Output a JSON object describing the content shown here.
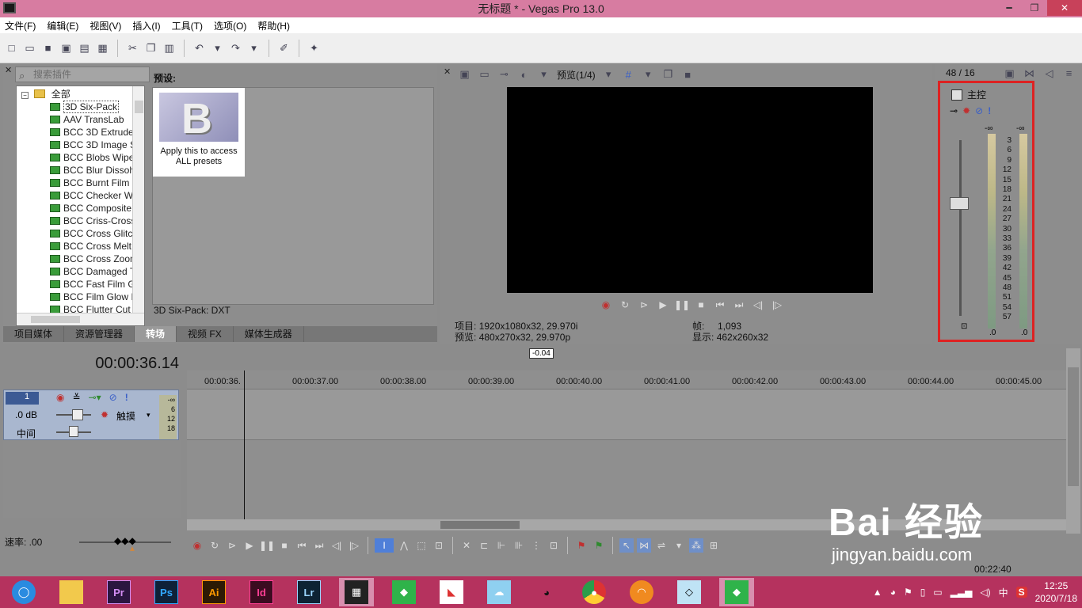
{
  "window": {
    "title": "无标题 * - Vegas Pro 13.0",
    "min": "━",
    "restore": "❐",
    "close": "✕"
  },
  "menu": [
    "文件(F)",
    "编辑(E)",
    "视图(V)",
    "插入(I)",
    "工具(T)",
    "选项(O)",
    "帮助(H)"
  ],
  "plugins": {
    "search_placeholder": "搜索插件",
    "root": "全部",
    "items": [
      "3D Six-Pack",
      "AAV TransLab",
      "BCC 3D Extrude",
      "BCC 3D Image S",
      "BCC Blobs Wipe",
      "BCC Blur Dissolv",
      "BCC Burnt Film",
      "BCC Checker Wi",
      "BCC Composite",
      "BCC Criss-Cross",
      "BCC Cross Glitch",
      "BCC Cross Melt",
      "BCC Cross Zoom",
      "BCC Damaged T",
      "BCC Fast Film G",
      "BCC Film Glow I",
      "BCC Flutter Cut"
    ],
    "preset_title": "预设:",
    "preset_caption_1": "Apply this to access",
    "preset_caption_2": "ALL presets",
    "preset_status": "3D Six-Pack: DXT"
  },
  "tabs": [
    "项目媒体",
    "资源管理器",
    "转场",
    "视频 FX",
    "媒体生成器"
  ],
  "preview": {
    "mode": "预览(1/4)",
    "project_label": "项目:",
    "project_value": "1920x1080x32, 29.970i",
    "preview_label": "预览:",
    "preview_value": "480x270x32, 29.970p",
    "frame_label": "帧:",
    "frame_value": "1,093",
    "display_label": "显示:",
    "display_value": "462x260x32"
  },
  "mixer": {
    "counter": "48 / 16",
    "master": "主控",
    "inf_left": "-∞",
    "inf_right": "-∞",
    "scale": [
      "3",
      "6",
      "9",
      "12",
      "15",
      "18",
      "21",
      "24",
      "27",
      "30",
      "33",
      "36",
      "39",
      "42",
      "45",
      "48",
      "51",
      "54",
      "57"
    ],
    "bottom_left": ".0",
    "bottom_right": ".0"
  },
  "timeline": {
    "time": "00:00:36.14",
    "offset": "-0.04",
    "ruler": [
      "00:00:36.",
      "00:00:37.00",
      "00:00:38.00",
      "00:00:39.00",
      "00:00:40.00",
      "00:00:41.00",
      "00:00:42.00",
      "00:00:43.00",
      "00:00:44.00",
      "00:00:45.00"
    ],
    "track_number": "1",
    "track_volume": ".0 dB",
    "track_pan": "中间",
    "track_mode": "触摸",
    "track_meter": [
      "-∞",
      "6",
      "12",
      "18"
    ],
    "rate_label": "速率: .00",
    "end_time": "00:22:40"
  },
  "taskbar": {
    "apps": [
      "Pr",
      "Ps",
      "Ai",
      "Id",
      "Lr"
    ],
    "ime": "中",
    "time": "12:25",
    "date": "2020/7/18"
  },
  "watermark": {
    "brand": "Bai 经验",
    "url": "jingyan.baidu.com"
  }
}
